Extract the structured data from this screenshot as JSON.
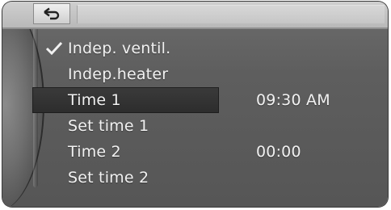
{
  "menu": {
    "items": [
      {
        "label": "Indep. ventil.",
        "value": "",
        "checked": true,
        "selected": false
      },
      {
        "label": "Indep.heater",
        "value": "",
        "checked": false,
        "selected": false
      },
      {
        "label": "Time 1",
        "value": "09:30 AM",
        "checked": false,
        "selected": true
      },
      {
        "label": "Set time 1",
        "value": "",
        "checked": false,
        "selected": false
      },
      {
        "label": "Time 2",
        "value": "00:00",
        "checked": false,
        "selected": false
      },
      {
        "label": "Set time 2",
        "value": "",
        "checked": false,
        "selected": false
      }
    ]
  },
  "icons": {
    "back": "back-arrow-icon",
    "check": "checkmark-icon"
  },
  "colors": {
    "screen_bg": "#5e5e5e",
    "text": "#f1f1f1",
    "selection_bg": "#333333",
    "topbar_bg": "#c6c6c6"
  }
}
